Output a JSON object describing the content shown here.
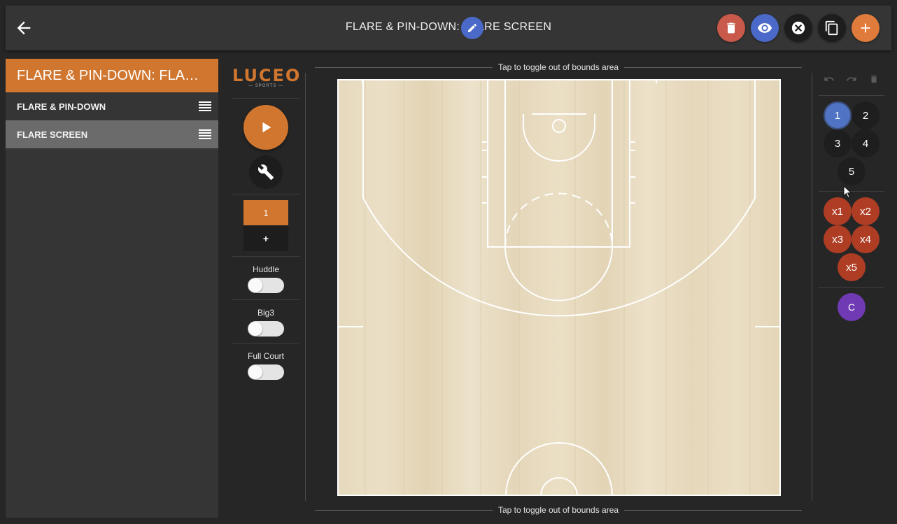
{
  "header": {
    "title": "FLARE & PIN-DOWN: FLARE SCREEN",
    "colors": {
      "delete": "#c9594a",
      "preview": "#4a69c8",
      "close": "#1d1d1d",
      "copy": "#1d1d1d",
      "add": "#e07b3c"
    }
  },
  "left_panel": {
    "play_title": "FLARE & PIN-DOWN: FLARE …",
    "sets": [
      {
        "label": "FLARE & PIN-DOWN",
        "active": false
      },
      {
        "label": "FLARE SCREEN",
        "active": true
      }
    ]
  },
  "toolbar": {
    "logo": "LUCEO",
    "logo_sub": "— SPORTS —",
    "frames": [
      "1"
    ],
    "add_frame_label": "+",
    "toggles": [
      {
        "label": "Huddle",
        "on": false
      },
      {
        "label": "Big3",
        "on": false
      },
      {
        "label": "Full Court",
        "on": false
      }
    ]
  },
  "court": {
    "oob_top": "Tap to toggle out of bounds area",
    "oob_bottom": "Tap to toggle out of bounds area"
  },
  "players": {
    "offense": [
      "1",
      "2",
      "3",
      "4",
      "5"
    ],
    "defense": [
      "x1",
      "x2",
      "x3",
      "x4",
      "x5"
    ],
    "coach": "C",
    "selected": "1"
  },
  "accent": "#d0762f"
}
